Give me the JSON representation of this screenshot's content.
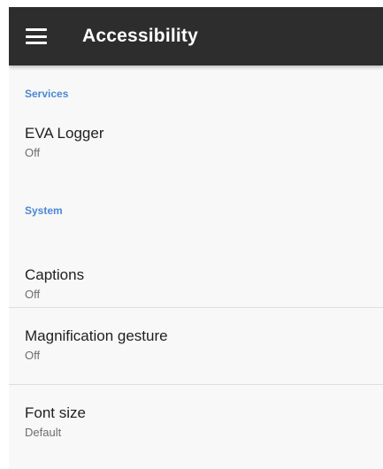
{
  "appbar": {
    "title": "Accessibility",
    "menu_icon": "hamburger-menu-icon"
  },
  "colors": {
    "appbar_bg": "#2d2d2d",
    "category_accent": "#4a88d6",
    "page_bg": "#f8f8f8"
  },
  "sections": [
    {
      "header": "Services",
      "items": [
        {
          "title": "EVA Logger",
          "summary": "Off"
        }
      ]
    },
    {
      "header": "System",
      "items": [
        {
          "title": "Captions",
          "summary": "Off"
        },
        {
          "title": "Magnification gesture",
          "summary": "Off"
        },
        {
          "title": "Font size",
          "summary": "Default"
        }
      ]
    }
  ]
}
